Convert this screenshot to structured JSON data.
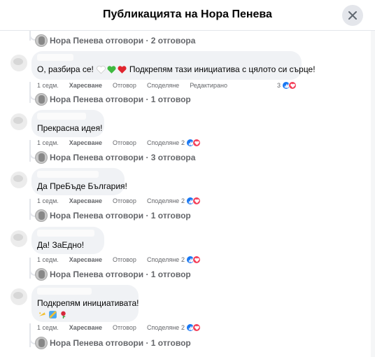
{
  "header": {
    "title": "Публикацията на Нора Пенева"
  },
  "reply_summaries": [
    "Нора Пенева отговори · 2 отговора",
    "Нора Пенева отговори · 1 отговор",
    "Нора Пенева отговори · 3 отговора",
    "Нора Пенева отговори · 1 отговор",
    "Нора Пенева отговори · 1 отговор",
    "Нора Пенева отговори · 1 отговор"
  ],
  "comments": [
    {
      "text_before": "О, разбира се!",
      "text_after": "Подкрепям тази инициатива с цялото си сърце!",
      "time": "1 седм.",
      "like": "Харесване",
      "reply": "Отговор",
      "share": "Споделяне",
      "edited": "Редактирано",
      "reaction_count": "3"
    },
    {
      "text": "Прекрасна идея!",
      "time": "1 седм.",
      "like": "Харесване",
      "reply": "Отговор",
      "share": "Споделяне",
      "reaction_count": "2"
    },
    {
      "text": "Да ПреБъде България!",
      "time": "1 седм.",
      "like": "Харесване",
      "reply": "Отговор",
      "share": "Споделяне",
      "reaction_count": "2"
    },
    {
      "text": "Да! ЗаЕдно!",
      "time": "1 седм.",
      "like": "Харесване",
      "reply": "Отговор",
      "share": "Споделяне",
      "reaction_count": "2"
    },
    {
      "text": "Подкрепям инициативата!",
      "time": "1 седм.",
      "like": "Харесване",
      "reply": "Отговор",
      "share": "Споделяне",
      "reaction_count": "2"
    }
  ],
  "icons": {
    "close": "close-icon",
    "like_reaction": "thumbs-up-icon",
    "love_reaction": "heart-icon"
  },
  "colors": {
    "like": "#1877f2",
    "love": "#f33e58",
    "bubble": "#f0f2f5",
    "meta": "#65676b"
  }
}
